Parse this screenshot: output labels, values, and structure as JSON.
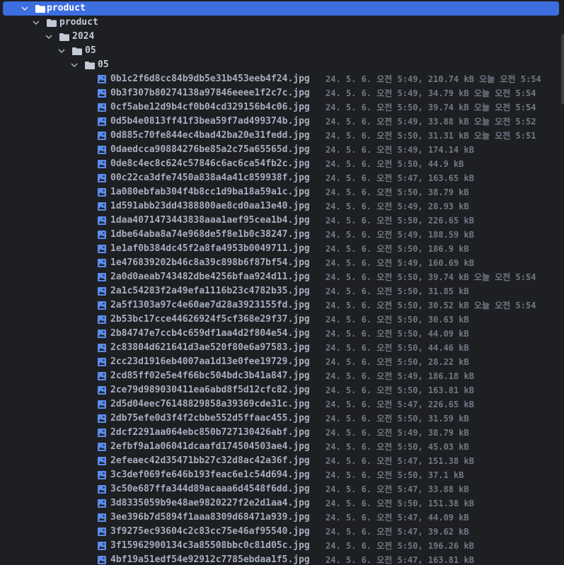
{
  "tree": {
    "root": {
      "label": "product"
    },
    "folders": [
      {
        "label": "product"
      },
      {
        "label": "2024"
      },
      {
        "label": "05"
      },
      {
        "label": "05"
      }
    ],
    "files": [
      {
        "name": "0b1c2f6d8cc84b9db5e31b453eeb4f24.jpg",
        "meta": "24. 5. 6. 오전 5:49, 210.74 kB 오늘 오전 5:54"
      },
      {
        "name": "0b3f307b80274138a97846eeee1f2c7c.jpg",
        "meta": "24. 5. 6. 오전 5:49, 34.79 kB 오늘 오전 5:54"
      },
      {
        "name": "0cf5abe12d9b4cf0b04cd329156b4c06.jpg",
        "meta": "24. 5. 6. 오전 5:50, 39.74 kB 오늘 오전 5:54"
      },
      {
        "name": "0d5b4e0813ff41f3bea59f7ad499374b.jpg",
        "meta": "24. 5. 6. 오전 5:49, 33.88 kB 오늘 오전 5:52"
      },
      {
        "name": "0d885c70fe844ec4bad42ba20e31fedd.jpg",
        "meta": "24. 5. 6. 오전 5:50, 31.31 kB 오늘 오전 5:51"
      },
      {
        "name": "0daedcca90884276be85a2c75a65565d.jpg",
        "meta": "24. 5. 6. 오전 5:49, 174.14 kB"
      },
      {
        "name": "0de8c4ec8c624c57846c6ac6ca54fb2c.jpg",
        "meta": "24. 5. 6. 오전 5:50, 44.9 kB"
      },
      {
        "name": "00c22ca3dfe7450a838a4a41c859938f.jpg",
        "meta": "24. 5. 6. 오전 5:47, 163.65 kB"
      },
      {
        "name": "1a080ebfab304f4b8cc1d9ba18a59a1c.jpg",
        "meta": "24. 5. 6. 오전 5:50, 38.79 kB"
      },
      {
        "name": "1d591abb23dd4388800ae8cd0aa13e40.jpg",
        "meta": "24. 5. 6. 오전 5:49, 28.93 kB"
      },
      {
        "name": "1daa4071473443838aaa1aef95cea1b4.jpg",
        "meta": "24. 5. 6. 오전 5:50, 226.65 kB"
      },
      {
        "name": "1dbe64aba8a74e968de5f8e1b0c38247.jpg",
        "meta": "24. 5. 6. 오전 5:49, 188.59 kB"
      },
      {
        "name": "1e1af0b384dc45f2a8fa4953b0049711.jpg",
        "meta": "24. 5. 6. 오전 5:50, 186.9 kB"
      },
      {
        "name": "1e476839202b46c8a39c898b6f87bf54.jpg",
        "meta": "24. 5. 6. 오전 5:49, 160.69 kB"
      },
      {
        "name": "2a0d0aeab743482dbe4256bfaa924d11.jpg",
        "meta": "24. 5. 6. 오전 5:50, 39.74 kB 오늘 오전 5:54"
      },
      {
        "name": "2a1c54283f2a49efa1116b23c4782b35.jpg",
        "meta": "24. 5. 6. 오전 5:50, 31.85 kB"
      },
      {
        "name": "2a5f1303a97c4e60ae7d28a3923155fd.jpg",
        "meta": "24. 5. 6. 오전 5:50, 30.52 kB 오늘 오전 5:54"
      },
      {
        "name": "2b53bc17cce44626924f5cf368e29f37.jpg",
        "meta": "24. 5. 6. 오전 5:50, 30.63 kB"
      },
      {
        "name": "2b84747e7ccb4c659df1aa4d2f804e54.jpg",
        "meta": "24. 5. 6. 오전 5:50, 44.09 kB"
      },
      {
        "name": "2c83804d621641d3ae520f80e6a97583.jpg",
        "meta": "24. 5. 6. 오전 5:50, 44.46 kB"
      },
      {
        "name": "2cc23d1916eb4007aa1d13e0fee19729.jpg",
        "meta": "24. 5. 6. 오전 5:50, 28.22 kB"
      },
      {
        "name": "2cd85ff02e5e4f66bc504bdc3b41a847.jpg",
        "meta": "24. 5. 6. 오전 5:49, 186.18 kB"
      },
      {
        "name": "2ce79d989030411ea6abd8f5d12cfc82.jpg",
        "meta": "24. 5. 6. 오전 5:50, 163.81 kB"
      },
      {
        "name": "2d5d04eec76148829858a39369cde31c.jpg",
        "meta": "24. 5. 6. 오전 5:47, 226.65 kB"
      },
      {
        "name": "2db75efe0d3f4f2cbbe552d5ffaac455.jpg",
        "meta": "24. 5. 6. 오전 5:50, 31.59 kB"
      },
      {
        "name": "2dcf2291aa064ebc850b727130426abf.jpg",
        "meta": "24. 5. 6. 오전 5:49, 38.79 kB"
      },
      {
        "name": "2efbf9a1a06041dcaafd174504503ae4.jpg",
        "meta": "24. 5. 6. 오전 5:50, 45.03 kB"
      },
      {
        "name": "2efeaec42d35471bb27c32d8ac42a36f.jpg",
        "meta": "24. 5. 6. 오전 5:47, 151.38 kB"
      },
      {
        "name": "3c3def069fe646b193feac6e1c54d694.jpg",
        "meta": "24. 5. 6. 오전 5:50, 37.1 kB"
      },
      {
        "name": "3c50e687ffa344d89acaaa6d4548f6dd.jpg",
        "meta": "24. 5. 6. 오전 5:47, 33.88 kB"
      },
      {
        "name": "3d8335059b9e48ae9820227f2e2d1aa4.jpg",
        "meta": "24. 5. 6. 오전 5:50, 151.38 kB"
      },
      {
        "name": "3ee396b7d5894f1aaa8309d68471a939.jpg",
        "meta": "24. 5. 6. 오전 5:47, 44.09 kB"
      },
      {
        "name": "3f9275ec93604c2c83cc75e46af95540.jpg",
        "meta": "24. 5. 6. 오전 5:47, 39.62 kB"
      },
      {
        "name": "3f15962900134c3a85508bbc0c81d05c.jpg",
        "meta": "24. 5. 6. 오전 5:50, 196.26 kB"
      },
      {
        "name": "4bf19a51edf54e92912c7785ebdaa1f5.jpg",
        "meta": "24. 5. 6. 오전 5:47, 163.81 kB"
      }
    ]
  },
  "colors": {
    "background": "#1e1f22",
    "selection": "#3d6ee0",
    "image_icon": "#5b8def",
    "folder_icon": "#c4cad6"
  },
  "icons": {
    "folder": "folder-icon",
    "file": "image-file-icon",
    "expand": "chevron-down-icon"
  }
}
